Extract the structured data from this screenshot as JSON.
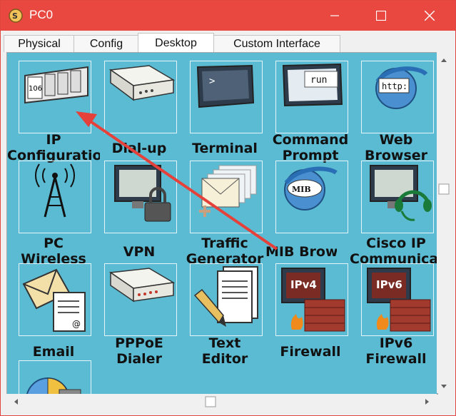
{
  "window": {
    "title": "PC0"
  },
  "tabs": [
    {
      "label": "Physical"
    },
    {
      "label": "Config"
    },
    {
      "label": "Desktop"
    },
    {
      "label": "Custom Interface"
    }
  ],
  "apps": {
    "ip_config": {
      "line1": "IP",
      "line2": "Configuratio"
    },
    "dialup": {
      "line1": "Dial-up"
    },
    "terminal": {
      "line1": "Terminal"
    },
    "command_prompt": {
      "line1": "Command",
      "line2": "Prompt",
      "icon_text": "run"
    },
    "web_browser": {
      "line1": "Web",
      "line2": "Browser",
      "icon_text": "http:"
    },
    "pc_wireless": {
      "line1": "PC",
      "line2": "Wireless"
    },
    "vpn": {
      "line1": "VPN"
    },
    "traffic_generator": {
      "line1": "Traffic",
      "line2": "Generator"
    },
    "mib_browser": {
      "line1": "MIB Brow",
      "icon_text": "MIB"
    },
    "cisco_ip": {
      "line1": "Cisco IP",
      "line2": "Communicat"
    },
    "email": {
      "line1": "Email"
    },
    "pppoe": {
      "line1": "PPPoE",
      "line2": "Dialer"
    },
    "text_editor": {
      "line1": "Text",
      "line2": "Editor"
    },
    "firewall": {
      "line1": "Firewall",
      "icon_text": "IPv4"
    },
    "ipv6_firewall": {
      "line1": "IPv6",
      "line2": "Firewall",
      "icon_text": "IPv6"
    },
    "ip_config_icon_text": "106"
  },
  "colors": {
    "titlebar": "#e8483f",
    "desktop": "#5bbbd3",
    "arrow": "#e5403a"
  }
}
